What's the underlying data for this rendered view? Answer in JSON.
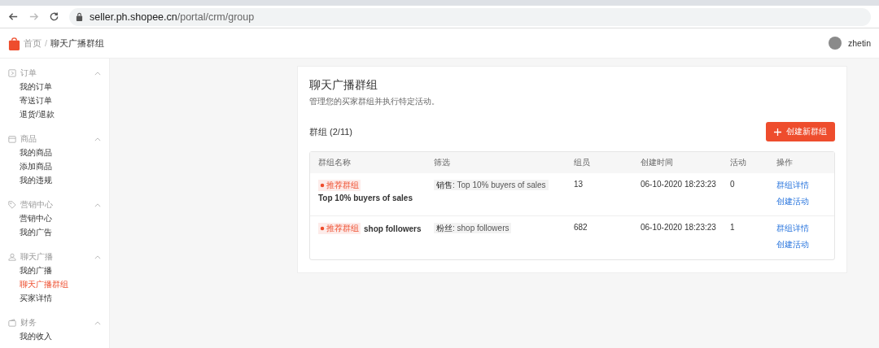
{
  "browser": {
    "url_host": "seller.ph.shopee.cn",
    "url_path": "/portal/crm/group"
  },
  "header": {
    "breadcrumb_separator": "/",
    "breadcrumb": [
      {
        "label": "首页",
        "selected": false
      },
      {
        "label": "聊天广播群组",
        "selected": true
      }
    ],
    "username": "zhetin"
  },
  "sidebar": [
    {
      "title": "订单",
      "kind": "order",
      "expanded": true,
      "items": [
        {
          "label": "我的订单",
          "selected": false
        },
        {
          "label": "寄送订单",
          "selected": false
        },
        {
          "label": "退货/退款",
          "selected": false
        }
      ]
    },
    {
      "title": "商品",
      "kind": "product",
      "expanded": true,
      "items": [
        {
          "label": "我的商品",
          "selected": false
        },
        {
          "label": "添加商品",
          "selected": false
        },
        {
          "label": "我的违规",
          "selected": false
        }
      ]
    },
    {
      "title": "营销中心",
      "kind": "tag",
      "expanded": true,
      "items": [
        {
          "label": "营销中心",
          "selected": false
        },
        {
          "label": "我的广告",
          "selected": false
        }
      ]
    },
    {
      "title": "聊天广播",
      "kind": "person",
      "expanded": true,
      "items": [
        {
          "label": "我的广播",
          "selected": false
        },
        {
          "label": "聊天广播群组",
          "selected": true
        },
        {
          "label": "买家详情",
          "selected": false
        }
      ]
    },
    {
      "title": "财务",
      "kind": "wallet",
      "expanded": true,
      "items": [
        {
          "label": "我的收入",
          "selected": false
        }
      ]
    }
  ],
  "page": {
    "title": "聊天广播群组",
    "subtitle": "管理您的买家群组并执行特定活动。",
    "count_label": "群组 (2/11)",
    "create_button": "创建新群组"
  },
  "table": {
    "columns": [
      "群组名称",
      "筛选",
      "组员",
      "创建时间",
      "活动",
      "操作"
    ],
    "rows": [
      {
        "tag": "推荐群组",
        "name": "Top 10% buyers of sales",
        "filter_label": "销售",
        "filter_value": ": Top 10% buyers of sales",
        "members": "13",
        "created": "06-10-2020 18:23:23",
        "activities": "0",
        "actions": [
          "群组详情",
          "创建活动"
        ]
      },
      {
        "tag": "推荐群组",
        "name": "shop followers",
        "filter_label": "粉丝",
        "filter_value": ": shop followers",
        "members": "682",
        "created": "06-10-2020 18:23:23",
        "activities": "1",
        "actions": [
          "群组详情",
          "创建活动"
        ]
      }
    ]
  }
}
